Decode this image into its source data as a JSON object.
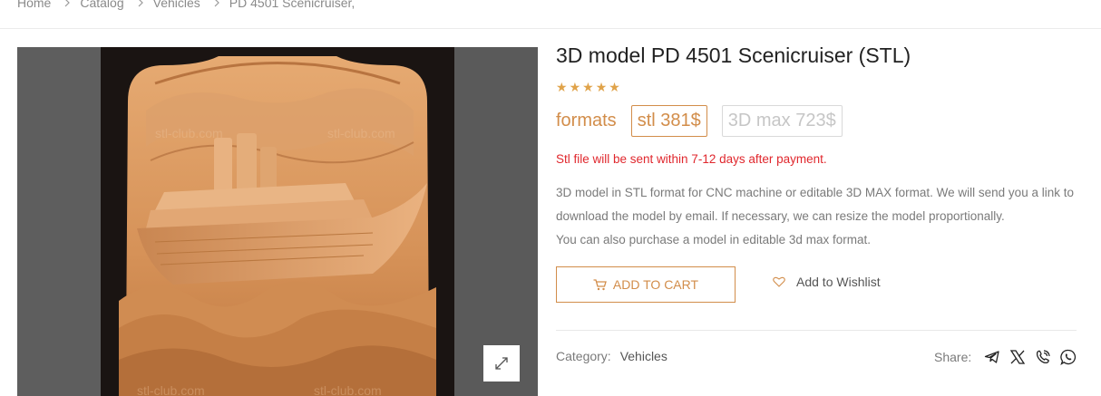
{
  "breadcrumb": {
    "items": [
      "Home",
      "Catalog",
      "Vehicles"
    ],
    "current": "PD 4501 Scenicruiser,"
  },
  "gallery": {
    "watermark": "stl-club.com",
    "zoom_icon": "expand-icon"
  },
  "product": {
    "title": "3D model PD 4501 Scenicruiser (STL)",
    "rating": 5,
    "formats_label": "formats",
    "formats": [
      {
        "label": "stl 381$",
        "active": true
      },
      {
        "label": "3D max 723$",
        "active": false
      }
    ],
    "notice": "Stl file will be sent within 7-12 days after payment.",
    "description": [
      "3D model in STL format for CNC machine or editable 3D MAX format. We will send you a link to download the model by email. If necessary, we can resize the model proportionally.",
      "You can also purchase a model in editable 3d max format."
    ]
  },
  "actions": {
    "add_to_cart": "ADD TO CART",
    "add_to_cart_icon": "cart-icon",
    "wishlist": "Add to Wishlist",
    "wishlist_icon": "heart-icon"
  },
  "meta": {
    "category_label": "Category:",
    "category_value": "Vehicles",
    "share_label": "Share:",
    "share_icons": [
      "telegram-icon",
      "x-twitter-icon",
      "viber-icon",
      "whatsapp-icon"
    ]
  },
  "colors": {
    "accent": "#d28d4a",
    "notice": "#e0272d",
    "star": "#e0a34a",
    "gallery_bg": "#585858"
  }
}
